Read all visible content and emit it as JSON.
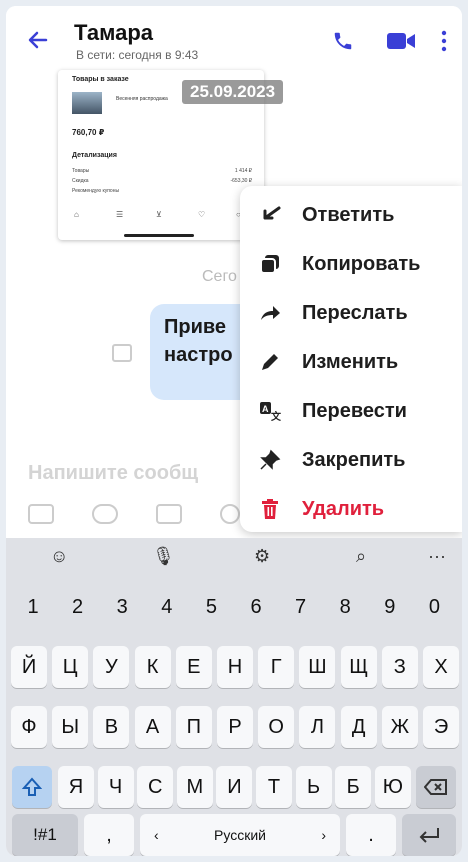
{
  "header": {
    "contact_name": "Тамара",
    "status": "В сети: сегодня в 9:43",
    "icons": [
      "back-arrow-icon",
      "phone-icon",
      "video-camera-icon",
      "more-vertical-icon"
    ],
    "accent": "#3a3fd6"
  },
  "chat": {
    "date_badge": "25.09.2023",
    "screenshot_card": {
      "heading": "Товары в заказе",
      "item": "Весенняя распродажа",
      "price": "760,70 ₽",
      "details_heading": "Детализация",
      "rows": [
        {
          "label": "Товары",
          "value": "1 414 ₽"
        },
        {
          "label": "Скидка",
          "value": "-653,30 ₽"
        },
        {
          "label": "Рекомендую купоны",
          "value": "-"
        }
      ]
    },
    "section_label": "Сего",
    "message": {
      "line1": "Приве",
      "line2": "настро"
    },
    "input_placeholder": "Напишите сообщ"
  },
  "menu": {
    "items": [
      {
        "label": "Ответить",
        "icon": "reply-icon"
      },
      {
        "label": "Копировать",
        "icon": "copy-icon"
      },
      {
        "label": "Переслать",
        "icon": "forward-icon"
      },
      {
        "label": "Изменить",
        "icon": "pencil-icon"
      },
      {
        "label": "Перевести",
        "icon": "translate-icon"
      },
      {
        "label": "Закрепить",
        "icon": "pin-icon"
      },
      {
        "label": "Удалить",
        "icon": "trash-icon"
      }
    ],
    "danger_color": "#e0203c"
  },
  "keyboard": {
    "toolbar": {
      "more": "···"
    },
    "numbers": [
      "1",
      "2",
      "3",
      "4",
      "5",
      "6",
      "7",
      "8",
      "9",
      "0"
    ],
    "row1": [
      "Й",
      "Ц",
      "У",
      "К",
      "Е",
      "Н",
      "Г",
      "Ш",
      "Щ",
      "З",
      "Х"
    ],
    "row2": [
      "Ф",
      "Ы",
      "В",
      "А",
      "П",
      "Р",
      "О",
      "Л",
      "Д",
      "Ж",
      "Э"
    ],
    "row3": [
      "Я",
      "Ч",
      "С",
      "М",
      "И",
      "Т",
      "Ь",
      "Б",
      "Ю"
    ],
    "bottom": {
      "symbols": "!#1",
      "comma": ",",
      "left": "‹",
      "space": "Русский",
      "right": "›",
      "period": "."
    }
  }
}
